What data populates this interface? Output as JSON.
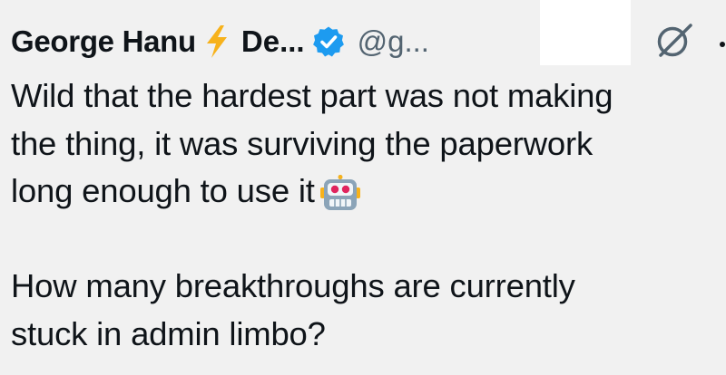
{
  "tweet": {
    "author_name": "George Hanu",
    "bolt_icon": "lightning-bolt-icon",
    "display_name_suffix": "De...",
    "verified_icon": "verified-badge-icon",
    "handle": "@g...",
    "grok_icon": "grok-icon",
    "more_icon": "more-options-icon",
    "body_lines": [
      "Wild that the hardest part was not making",
      "the thing, it was surviving the paperwork",
      "long enough to use it",
      "How many breakthroughs are currently",
      "stuck in admin limbo?"
    ],
    "emoji": "robot-face-emoji",
    "colors": {
      "background": "#f1f1f1",
      "text": "#0f1419",
      "handle": "#536471",
      "verified": "#1d9bf0",
      "bolt": "#f7b21b"
    }
  }
}
